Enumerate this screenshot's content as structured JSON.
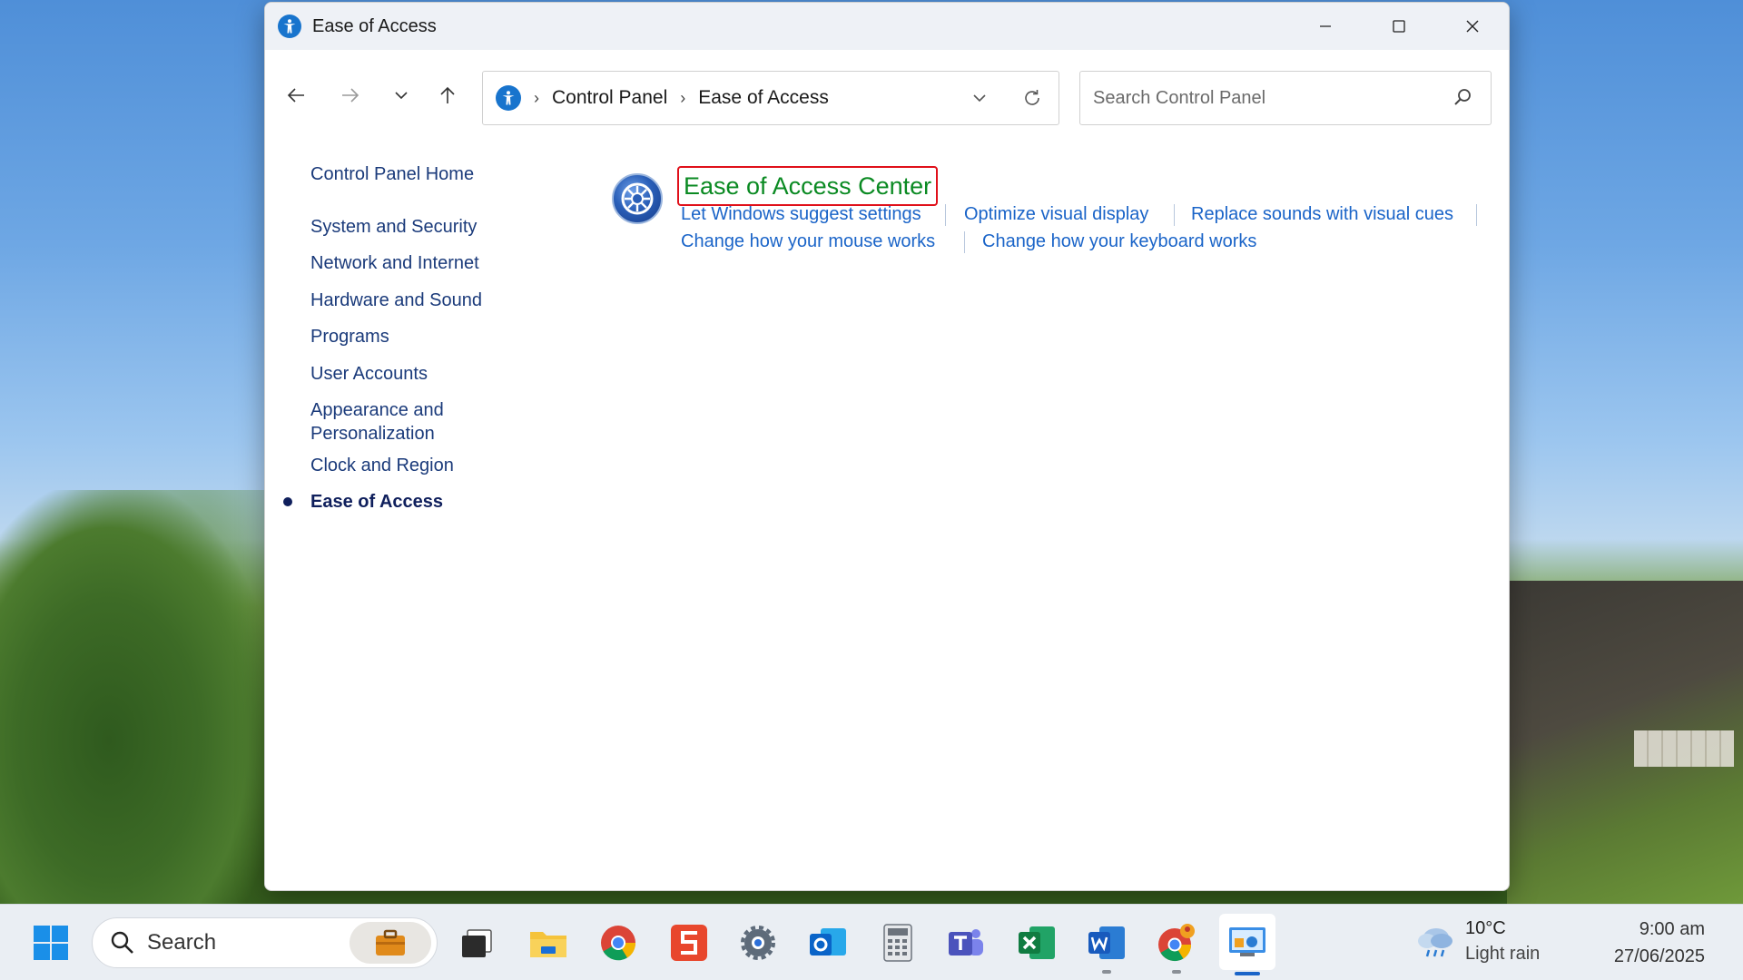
{
  "window": {
    "title": "Ease of Access"
  },
  "address_bar": {
    "breadcrumb": [
      "Control Panel",
      "Ease of Access"
    ]
  },
  "search": {
    "placeholder": "Search Control Panel"
  },
  "left_nav": {
    "items": [
      {
        "label": "Control Panel Home"
      },
      {
        "label": "System and Security"
      },
      {
        "label": "Network and Internet"
      },
      {
        "label": "Hardware and Sound"
      },
      {
        "label": "Programs"
      },
      {
        "label": "User Accounts"
      },
      {
        "label": "Appearance and Personalization"
      },
      {
        "label": "Clock and Region"
      },
      {
        "label": "Ease of Access",
        "active": true
      }
    ]
  },
  "content": {
    "heading": "Ease of Access Center",
    "tasks": [
      "Let Windows suggest settings",
      "Optimize visual display",
      "Replace sounds with visual cues",
      "Change how your mouse works",
      "Change how your keyboard works"
    ]
  },
  "taskbar": {
    "search_label": "Search",
    "weather": {
      "temperature": "10°C",
      "condition": "Light rain"
    },
    "clock": {
      "time": "9:00 am",
      "date": "27/06/2025"
    },
    "apps": [
      "start",
      "widgets-briefcase",
      "task-view",
      "file-explorer",
      "chrome",
      "wps-office",
      "settings",
      "outlook",
      "calculator",
      "teams",
      "excel",
      "word",
      "chrome-profile",
      "control-panel"
    ]
  }
}
